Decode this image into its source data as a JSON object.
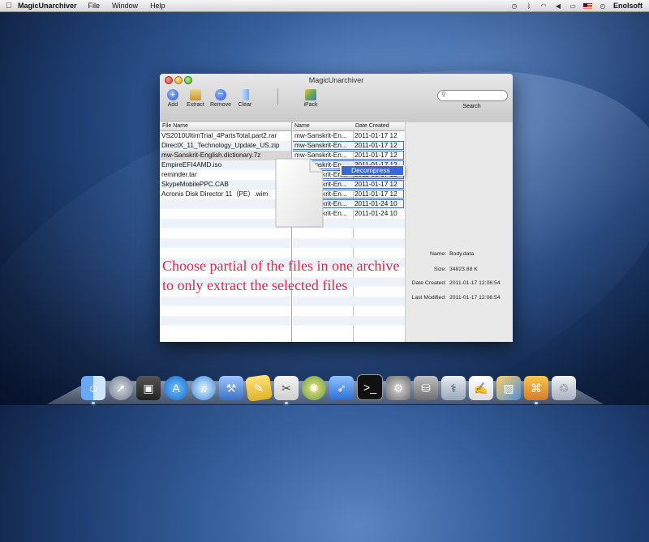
{
  "menubar": {
    "app_name": "MagicUnarchiver",
    "menus": [
      "File",
      "Window",
      "Help"
    ],
    "user": "Enolsoft"
  },
  "window": {
    "title": "MagicUnarchiver",
    "toolbar": {
      "add": "Add",
      "extract": "Extract",
      "remove": "Remove",
      "clear": "Clear",
      "ipack": "iPack",
      "search_label": "Search"
    },
    "archives": {
      "header": "File Name",
      "items": [
        "VS2010UltimTrial_4PartsTotal.part2.rar",
        "DirectX_11_Technology_Update_US.zip",
        "mw-Sanskrit-English.dictionary.7z",
        "EmpireEFI4AMD.iso",
        "reminder.tar",
        "SkypeMobilePPC.CAB",
        "Acronis Disk Director 11（PE）.wim"
      ],
      "selected_index": 2
    },
    "contents": {
      "header_name": "Name",
      "header_date": "Date Created",
      "rows": [
        {
          "name": "mw-Sanskrit-En...",
          "date": "2011-01-17 12"
        },
        {
          "name": "mw-Sanskrit-En...",
          "date": "2011-01-17 12"
        },
        {
          "name": "mw-Sanskrit-En...",
          "date": "2011-01-17 12"
        },
        {
          "name": "mw-Sanskrit-En...",
          "date": "2011-01-17 12"
        },
        {
          "name": "mw-Sanskrit-En...",
          "date": "2011-01-17 12"
        },
        {
          "name": "mw-Sanskrit-En...",
          "date": "2011-01-17 12"
        },
        {
          "name": "mw-Sanskrit-En...",
          "date": "2011-01-17 12"
        },
        {
          "name": "mw-Sanskrit-En...",
          "date": "2011-01-24 10"
        },
        {
          "name": "mw-Sanskrit-En...",
          "date": "2011-01-24 10"
        }
      ]
    },
    "context_menu": {
      "item": "Decompress"
    },
    "info": {
      "name_label": "Name:",
      "name_value": "Body.data",
      "size_label": "Size:",
      "size_value": "34823.88 K",
      "created_label": "Date Created:",
      "created_value": "2011-01-17 12:06:54",
      "modified_label": "Last Modified:",
      "modified_value": "2011-01-17 12:06:54"
    }
  },
  "annotation": {
    "line1": "Choose partial of the files in one archive",
    "line2": "to only extract the selected files"
  },
  "dock": {
    "icons": [
      "finder-icon",
      "launchpad-icon",
      "photo-booth-icon",
      "app-store-icon",
      "itunes-icon",
      "xcode-icon",
      "notes-icon",
      "preview-icon",
      "aperture-icon",
      "rocket-icon",
      "terminal-icon",
      "system-preferences-icon",
      "disk-utility-icon",
      "grapher-icon",
      "textedit-icon",
      "photo-icon",
      "archive-icon",
      "trash-icon"
    ]
  }
}
